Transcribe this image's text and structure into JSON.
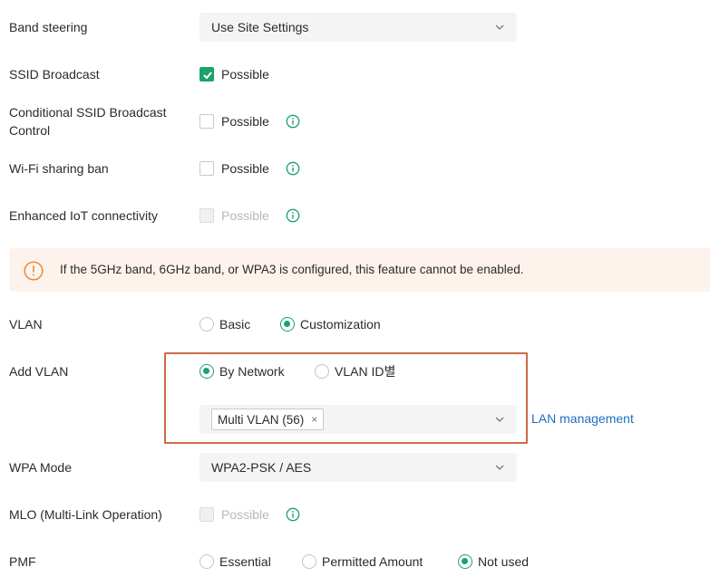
{
  "band_steering": {
    "label": "Band steering",
    "value": "Use Site Settings"
  },
  "ssid_broadcast": {
    "label": "SSID Broadcast",
    "option": "Possible",
    "checked": true
  },
  "conditional_ssid": {
    "label_line1": "Conditional SSID Broadcast",
    "label_line2": "Control",
    "option": "Possible",
    "checked": false
  },
  "wifi_sharing_ban": {
    "label": "Wi-Fi sharing ban",
    "option": "Possible",
    "checked": false
  },
  "enhanced_iot": {
    "label": "Enhanced IoT connectivity",
    "option": "Possible",
    "disabled": true
  },
  "notice": {
    "text": "If the 5GHz band, 6GHz band, or WPA3 is configured, this feature cannot be enabled."
  },
  "vlan": {
    "label": "VLAN",
    "options": [
      "Basic",
      "Customization"
    ],
    "selected": "Customization"
  },
  "add_vlan": {
    "label": "Add VLAN",
    "options": [
      "By Network",
      "VLAN ID별"
    ],
    "selected": "By Network",
    "tag": "Multi VLAN (56)",
    "tag_remove": "×",
    "link": "LAN management"
  },
  "wpa_mode": {
    "label": "WPA Mode",
    "value": "WPA2-PSK / AES"
  },
  "mlo": {
    "label": "MLO (Multi-Link Operation)",
    "option": "Possible",
    "disabled": true
  },
  "pmf": {
    "label": "PMF",
    "options": [
      "Essential",
      "Permitted Amount",
      "Not used"
    ],
    "selected": "Not used"
  },
  "colors": {
    "accent": "#1aa36b",
    "warning": "#e8893f",
    "link": "#1f6dc2",
    "highlight_border": "#d16a4a"
  }
}
